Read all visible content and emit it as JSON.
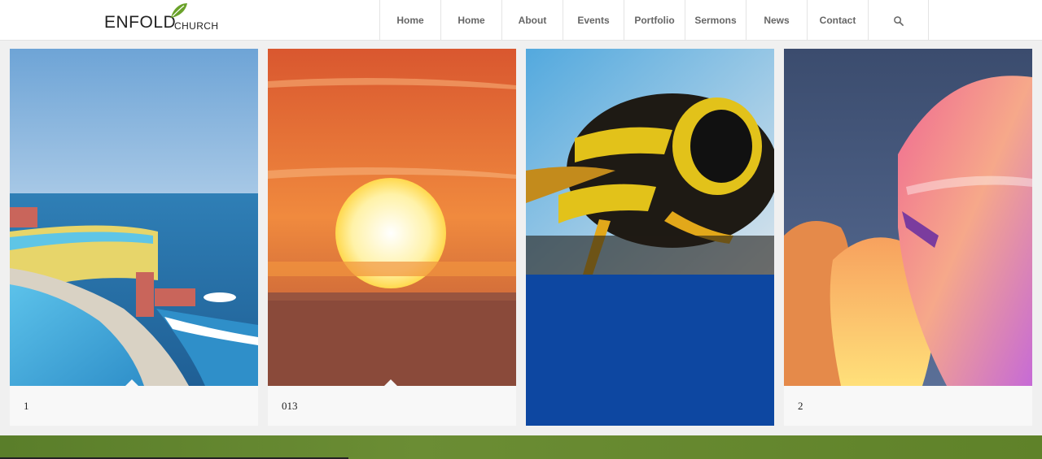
{
  "logo": {
    "text_main": "ENFOLD",
    "text_sub": "CHURCH"
  },
  "nav": {
    "items": [
      "Home",
      "Home",
      "About",
      "Events",
      "Portfolio",
      "Sermons",
      "News",
      "Contact"
    ],
    "search_icon": "search-icon"
  },
  "colors": {
    "accent": "#0d47a1",
    "footer": "#5a7e2a"
  },
  "cards": [
    {
      "caption": "1",
      "image": "pool-sea-photo"
    },
    {
      "caption": "013",
      "image": "sunset-photo"
    },
    {
      "caption": "",
      "image": "wasp-photo"
    },
    {
      "caption": "2",
      "image": "hot-air-balloons-photo"
    }
  ]
}
